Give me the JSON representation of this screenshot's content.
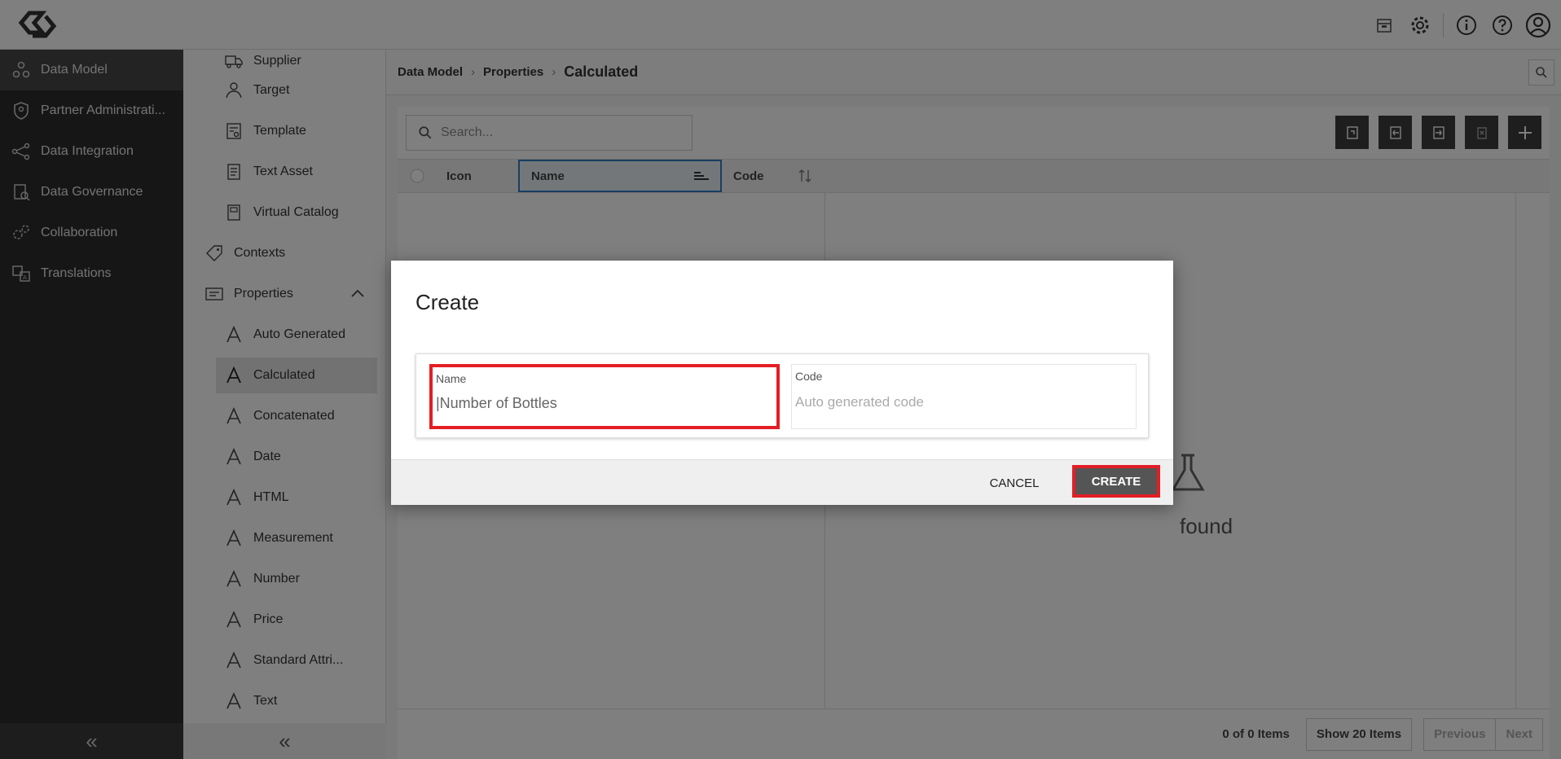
{
  "topbar": {
    "icons": [
      "archive-icon",
      "gear-icon",
      "info-icon",
      "help-icon",
      "user-icon"
    ]
  },
  "nav": {
    "items": [
      {
        "label": "Data Model",
        "icon": "data-model-icon",
        "active": true
      },
      {
        "label": "Partner Administrati...",
        "icon": "shield-icon"
      },
      {
        "label": "Data Integration",
        "icon": "network-icon"
      },
      {
        "label": "Data Governance",
        "icon": "governance-icon"
      },
      {
        "label": "Collaboration",
        "icon": "collaboration-icon"
      },
      {
        "label": "Translations",
        "icon": "translate-icon"
      }
    ],
    "collapse": "«"
  },
  "tree": {
    "items": [
      {
        "label": "Supplier",
        "icon": "truck-icon"
      },
      {
        "label": "Target",
        "icon": "person-icon"
      },
      {
        "label": "Template",
        "icon": "template-icon"
      },
      {
        "label": "Text Asset",
        "icon": "document-icon"
      },
      {
        "label": "Virtual Catalog",
        "icon": "book-icon"
      },
      {
        "label": "Contexts",
        "icon": "tag-icon"
      },
      {
        "label": "Properties",
        "icon": "properties-icon"
      },
      {
        "label": "Auto Generated",
        "icon": "letter-a-icon"
      },
      {
        "label": "Calculated",
        "icon": "letter-a-icon",
        "selected": true
      },
      {
        "label": "Concatenated",
        "icon": "letter-a-icon"
      },
      {
        "label": "Date",
        "icon": "letter-a-icon"
      },
      {
        "label": "HTML",
        "icon": "letter-a-icon"
      },
      {
        "label": "Measurement",
        "icon": "letter-a-icon"
      },
      {
        "label": "Number",
        "icon": "letter-a-icon"
      },
      {
        "label": "Price",
        "icon": "letter-a-icon"
      },
      {
        "label": "Standard Attri...",
        "icon": "letter-a-icon"
      },
      {
        "label": "Text",
        "icon": "letter-a-icon"
      }
    ],
    "collapse": "«"
  },
  "breadcrumb": {
    "items": [
      "Data Model",
      "Properties"
    ],
    "current": "Calculated"
  },
  "grid": {
    "search_placeholder": "Search...",
    "columns": [
      "Icon",
      "Name",
      "Code"
    ],
    "empty_text": "found",
    "footer": {
      "count": "0 of 0 Items",
      "show": "Show 20 Items",
      "previous": "Previous",
      "next": "Next"
    }
  },
  "dialog": {
    "title": "Create",
    "name_label": "Name",
    "name_value": "|Number of Bottles",
    "code_label": "Code",
    "code_placeholder": "Auto generated code",
    "cancel": "CANCEL",
    "create": "CREATE"
  },
  "colors": {
    "highlight": "#e31e24",
    "nav_bg": "#2d2d2d",
    "button_dark": "#3d3d3d"
  }
}
